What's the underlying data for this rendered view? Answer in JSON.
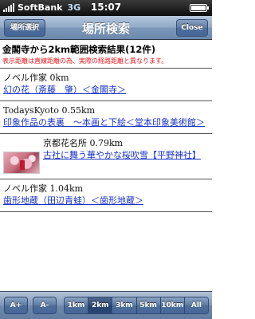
{
  "status_bar": {
    "carrier": "SoftBank",
    "network": "3G",
    "time": "15:07"
  },
  "nav": {
    "title": "場所検索",
    "left_button": "場所選択",
    "right_button": "Close"
  },
  "results": {
    "title": "金閣寺から2km範囲検索結果(12件)",
    "note": "表示距離は直線距離の為、実際の経路距離と異なります。",
    "items": [
      {
        "source": "ノベル作家 0km",
        "link": "幻の花（斎藤　肇）＜金閣寺＞"
      },
      {
        "source": "TodaysKyoto 0.55km",
        "link": "印象作品の表裏　～本画と下絵＜堂本印象美術館＞"
      },
      {
        "source": "京都花名所 0.79km",
        "link": "古社に舞う華やかな桜吹雪【平野神社】"
      },
      {
        "source": "ノベル作家 1.04km",
        "link": "歯形地蔵（田辺青蛙）＜歯形地蔵＞"
      }
    ]
  },
  "toolbar": {
    "font_up": "A+",
    "font_down": "A-",
    "ranges": [
      "1km",
      "2km",
      "3km",
      "5km",
      "10km",
      "All"
    ],
    "selected_range": "2km"
  },
  "colors": {
    "link": "#1a33c8",
    "note": "#e0161c",
    "nav_blue": "#6c88ac"
  }
}
